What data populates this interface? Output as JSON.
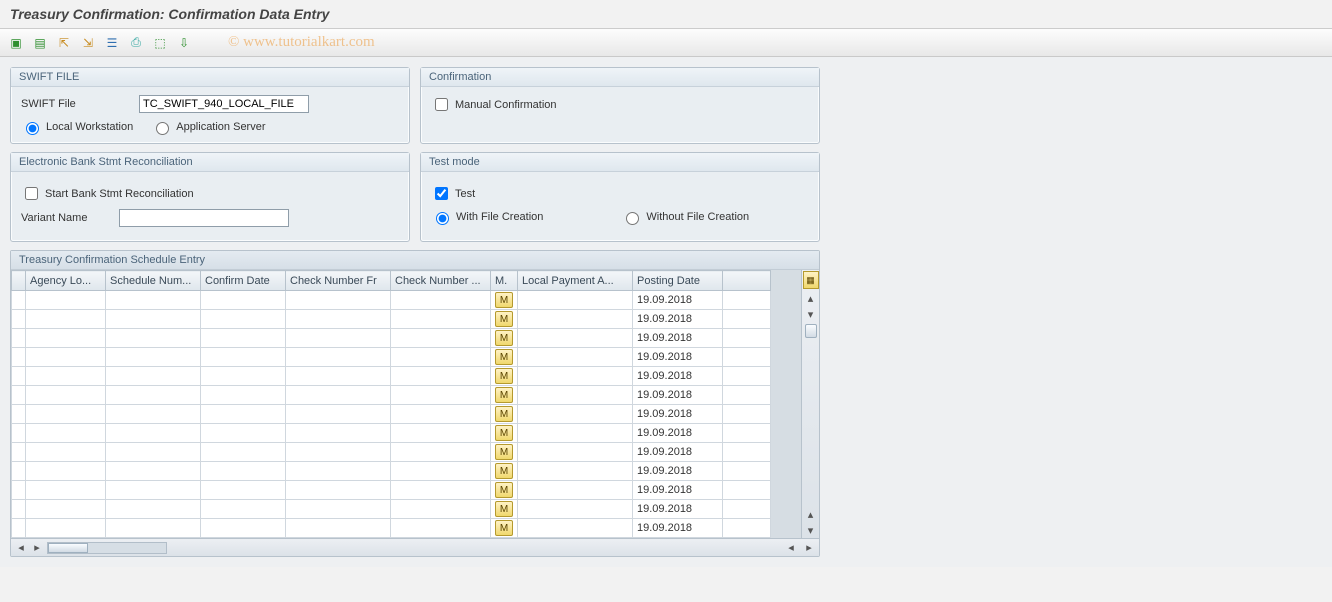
{
  "title": "Treasury Confirmation: Confirmation Data Entry",
  "watermark": "© www.tutorialkart.com",
  "toolbar_icons": [
    "execute",
    "get-variant",
    "row-up",
    "row-down",
    "sort",
    "print",
    "export-xls",
    "export-local"
  ],
  "panels": {
    "swift": {
      "title": "SWIFT FILE",
      "file_label": "SWIFT File",
      "file_value": "TC_SWIFT_940_LOCAL_FILE",
      "opt_local": "Local Workstation",
      "opt_server": "Application Server",
      "selected": "local"
    },
    "confirm": {
      "title": "Confirmation",
      "manual_label": "Manual Confirmation",
      "manual_checked": false
    },
    "recon": {
      "title": "Electronic Bank Stmt Reconciliation",
      "start_label": "Start Bank Stmt Reconciliation",
      "start_checked": false,
      "variant_label": "Variant Name",
      "variant_value": ""
    },
    "test": {
      "title": "Test mode",
      "test_label": "Test",
      "test_checked": true,
      "opt_with": "With File Creation",
      "opt_without": "Without File Creation",
      "selected": "with"
    }
  },
  "table": {
    "title": "Treasury Confirmation Schedule Entry",
    "columns": {
      "agency": "Agency Lo...",
      "sched": "Schedule Num...",
      "cdate": "Confirm Date",
      "chkfr": "Check Number Fr",
      "chkto": "Check Number ...",
      "m": "M.",
      "lpa": "Local Payment A...",
      "pdate": "Posting Date"
    },
    "m_button": "M",
    "rows": [
      {
        "agency": "",
        "sched": "",
        "cdate": "",
        "chkfr": "",
        "chkto": "",
        "lpa": "",
        "pdate": "19.09.2018"
      },
      {
        "agency": "",
        "sched": "",
        "cdate": "",
        "chkfr": "",
        "chkto": "",
        "lpa": "",
        "pdate": "19.09.2018"
      },
      {
        "agency": "",
        "sched": "",
        "cdate": "",
        "chkfr": "",
        "chkto": "",
        "lpa": "",
        "pdate": "19.09.2018"
      },
      {
        "agency": "",
        "sched": "",
        "cdate": "",
        "chkfr": "",
        "chkto": "",
        "lpa": "",
        "pdate": "19.09.2018"
      },
      {
        "agency": "",
        "sched": "",
        "cdate": "",
        "chkfr": "",
        "chkto": "",
        "lpa": "",
        "pdate": "19.09.2018"
      },
      {
        "agency": "",
        "sched": "",
        "cdate": "",
        "chkfr": "",
        "chkto": "",
        "lpa": "",
        "pdate": "19.09.2018"
      },
      {
        "agency": "",
        "sched": "",
        "cdate": "",
        "chkfr": "",
        "chkto": "",
        "lpa": "",
        "pdate": "19.09.2018"
      },
      {
        "agency": "",
        "sched": "",
        "cdate": "",
        "chkfr": "",
        "chkto": "",
        "lpa": "",
        "pdate": "19.09.2018"
      },
      {
        "agency": "",
        "sched": "",
        "cdate": "",
        "chkfr": "",
        "chkto": "",
        "lpa": "",
        "pdate": "19.09.2018"
      },
      {
        "agency": "",
        "sched": "",
        "cdate": "",
        "chkfr": "",
        "chkto": "",
        "lpa": "",
        "pdate": "19.09.2018"
      },
      {
        "agency": "",
        "sched": "",
        "cdate": "",
        "chkfr": "",
        "chkto": "",
        "lpa": "",
        "pdate": "19.09.2018"
      },
      {
        "agency": "",
        "sched": "",
        "cdate": "",
        "chkfr": "",
        "chkto": "",
        "lpa": "",
        "pdate": "19.09.2018"
      },
      {
        "agency": "",
        "sched": "",
        "cdate": "",
        "chkfr": "",
        "chkto": "",
        "lpa": "",
        "pdate": "19.09.2018"
      }
    ]
  }
}
